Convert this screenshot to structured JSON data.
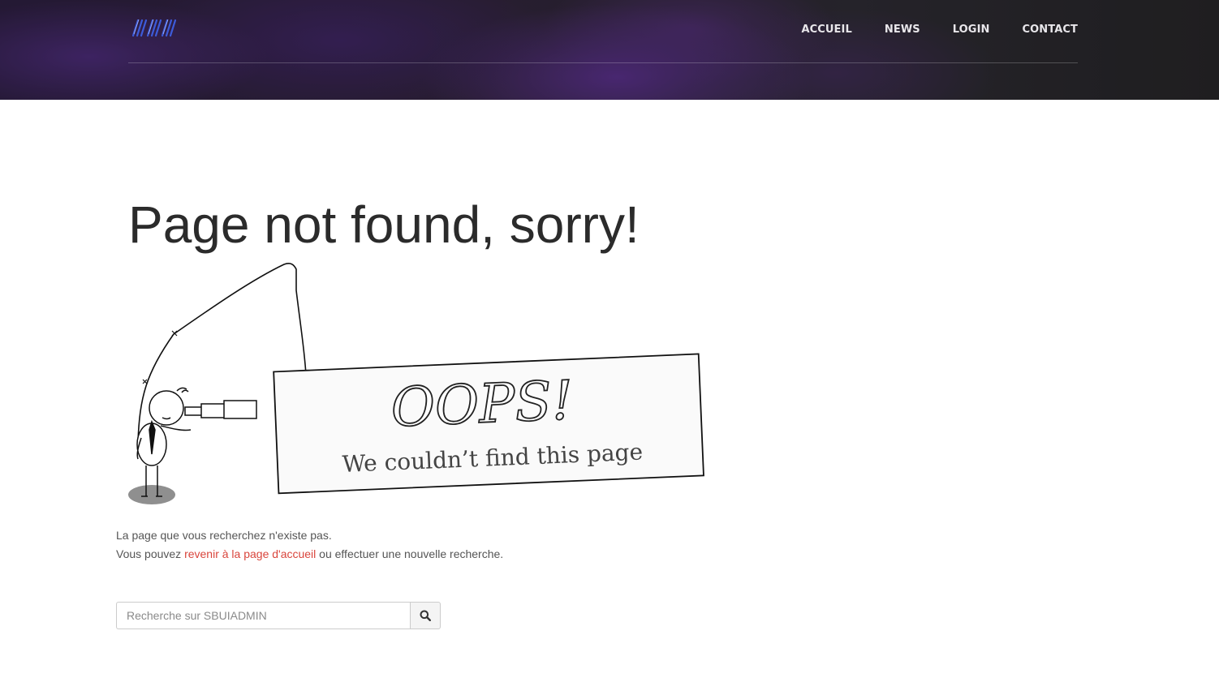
{
  "nav": {
    "items": [
      {
        "label": "ACCUEIL"
      },
      {
        "label": "NEWS"
      },
      {
        "label": "LOGIN"
      },
      {
        "label": "CONTACT"
      }
    ]
  },
  "main": {
    "title": "Page not found, sorry!",
    "illustration": {
      "sign_heading": "OOPS!",
      "sign_subtext": "We couldn’t find this page"
    },
    "message": {
      "line1": "La page que vous recherchez n'existe pas.",
      "line2_prefix": "Vous pouvez ",
      "line2_link": "revenir à la page d'accueil",
      "line2_suffix": " ou effectuer une nouvelle recherche."
    },
    "search": {
      "placeholder": "Recherche sur SBUIADMIN",
      "button_icon": "search-icon"
    }
  },
  "colors": {
    "link": "#d9453c",
    "title": "#2b2b2b",
    "nav_text": "#e8e6ea"
  }
}
